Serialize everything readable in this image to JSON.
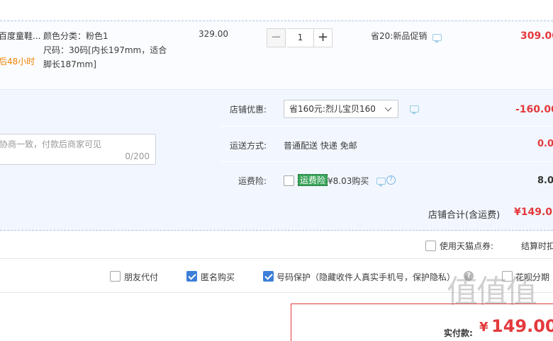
{
  "item": {
    "title": "百度童鞋...",
    "promise": "后48小时",
    "sku_color": "颜色分类：粉色1",
    "sku_size_line1": "尺码：30码[内长197mm，适合",
    "sku_size_line2": "脚长187mm]",
    "unit_price": "329.00",
    "qty_minus": "−",
    "quantity": "1",
    "qty_plus": "+",
    "promo_text": "省20:新品促销",
    "subtotal": "309.00"
  },
  "shop_promo": {
    "label": "店铺优惠:",
    "selected": "省160元:烈儿宝贝160",
    "amount": "-160.00"
  },
  "shipping": {
    "label": "运送方式:",
    "value": "普通配送 快递 免邮",
    "amount": "0.0"
  },
  "freight_insurance": {
    "label": "运费险:",
    "tag": "运费险",
    "price": "¥8.03购买",
    "amount": "8.0"
  },
  "memo": {
    "placeholder": "协商一致，付款后商家可见",
    "counter": "0/200"
  },
  "shop_total": {
    "label": "店铺合计(含运费)",
    "amount": "¥149.0"
  },
  "tmall_points": {
    "label": "使用天猫点券:",
    "note": "结算时扣"
  },
  "options": {
    "friend_pay": "朋友代付",
    "anonymous": "匿名购买",
    "number_protect": "号码保护（隐藏收件人真实手机号，保护隐私）",
    "huabei": "花呗分期"
  },
  "payment": {
    "label": "实付款:",
    "currency": "¥",
    "amount": "149.00"
  },
  "watermark": "值值值",
  "colors": {
    "accent_red": "#e4393c",
    "promise_orange": "#f08200",
    "checkbox_blue": "#3d7fd8",
    "tag_green": "#3aa45a"
  }
}
